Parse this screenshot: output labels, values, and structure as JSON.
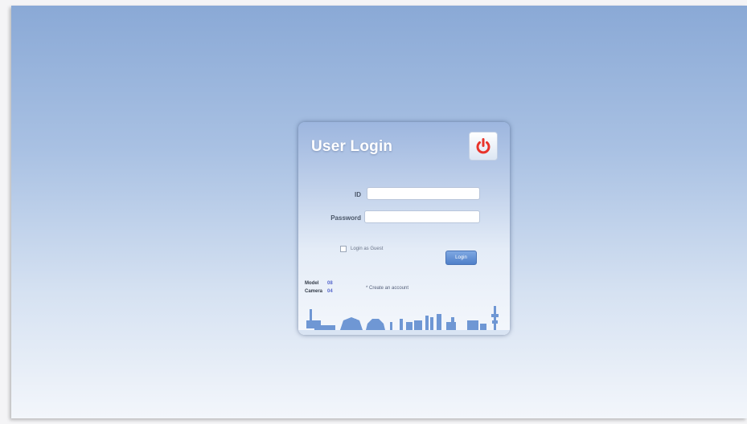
{
  "login": {
    "title": "User Login",
    "id_label": "ID",
    "id_value": "",
    "password_label": "Password",
    "password_value": "",
    "remember_label": "Login as Guest",
    "login_button": "Login",
    "create_account": "* Create an account"
  },
  "stats": {
    "model_label": "Model",
    "model_value": "08",
    "camera_label": "Camera",
    "camera_value": "04"
  },
  "colors": {
    "power_icon": "#e8342b",
    "accent": "#5a87cf",
    "skyline": "#6f97d4"
  },
  "icons": {
    "power": "power-icon",
    "skyline": "city-skyline-decoration"
  }
}
